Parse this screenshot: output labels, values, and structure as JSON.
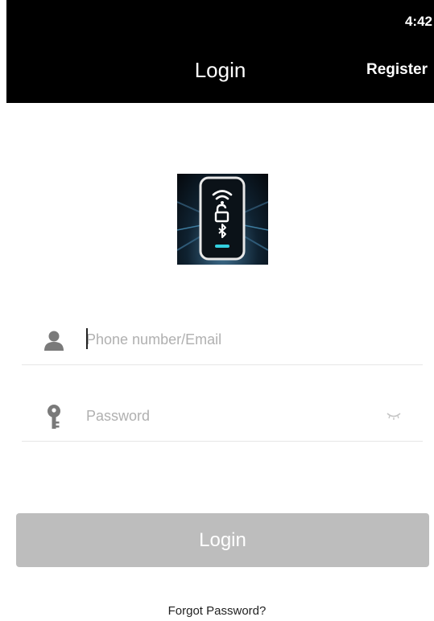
{
  "status_bar": {
    "time": "4:42"
  },
  "header": {
    "title": "Login",
    "register_label": "Register"
  },
  "logo": {
    "icon": "smart-lock-app-logo"
  },
  "form": {
    "phone": {
      "icon": "user-icon",
      "placeholder": "Phone number/Email",
      "value": ""
    },
    "password": {
      "icon": "key-icon",
      "placeholder": "Password",
      "value": "",
      "toggle_icon": "eye-closed-icon"
    }
  },
  "actions": {
    "login_label": "Login",
    "forgot_label": "Forgot Password?"
  },
  "colors": {
    "header_bg": "#000000",
    "button_disabled": "#bdbdbd",
    "icon_gray": "#7a7a7a",
    "accent_teal": "#33d0e0"
  }
}
